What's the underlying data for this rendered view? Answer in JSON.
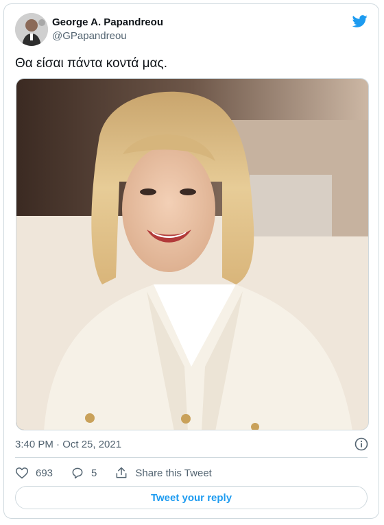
{
  "tweet": {
    "author_name": "George A. Papandreou",
    "author_handle": "@GPapandreou",
    "text": "Θα είσαι πάντα κοντά μας.",
    "timestamp": "3:40 PM · Oct 25, 2021",
    "likes": "693",
    "replies": "5",
    "share_label": "Share this Tweet",
    "reply_label": "Tweet your reply"
  },
  "colors": {
    "accent": "#1d9bf0",
    "secondary_text": "#536471",
    "border": "#cfd9de"
  },
  "icons": {
    "brand": "twitter-bird-icon",
    "info": "info-icon",
    "like": "heart-icon",
    "reply": "comment-icon",
    "share": "share-icon"
  }
}
